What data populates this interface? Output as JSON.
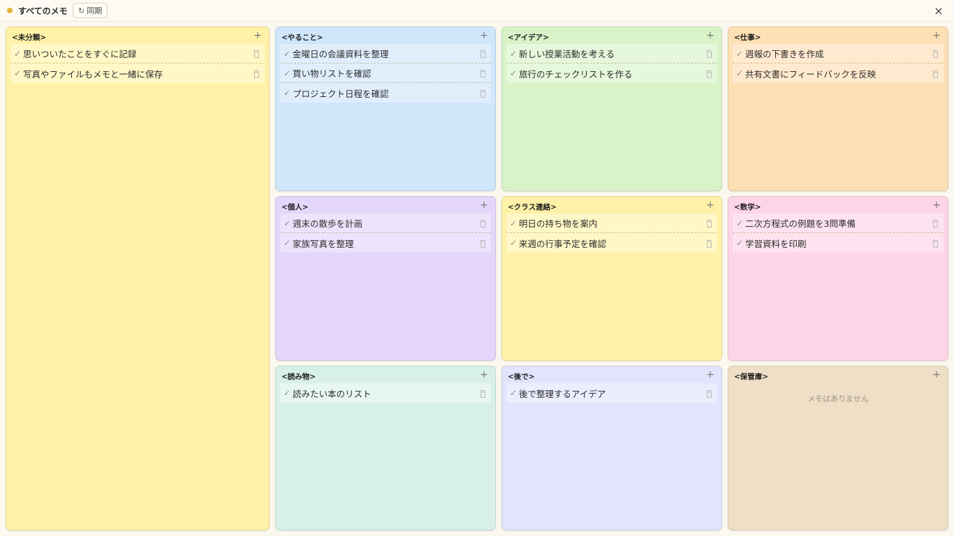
{
  "header": {
    "title": "すべてのメモ",
    "sync_icon": "↻",
    "sync_label": "同期",
    "close_icon": "×"
  },
  "icons": {
    "add": "+",
    "check": "✓"
  },
  "colors": {
    "status_dot": "#e3b63a"
  },
  "panels": [
    {
      "id": "uncategorized",
      "title": "<未分類>",
      "bg": "#fff2a8",
      "note_bg": "#fff7c6",
      "notes": [
        "思いついたことをすぐに記録",
        "写真やファイルもメモと一緒に保存"
      ],
      "empty_text": ""
    },
    {
      "id": "todo",
      "title": "<やること>",
      "bg": "#cfe6fb",
      "note_bg": "#e0eefc",
      "notes": [
        "金曜日の会議資料を整理",
        "買い物リストを確認",
        "プロジェクト日程を確認"
      ],
      "empty_text": ""
    },
    {
      "id": "ideas",
      "title": "<アイデア>",
      "bg": "#d8f3c8",
      "note_bg": "#e6f8dc",
      "notes": [
        "新しい授業活動を考える",
        "旅行のチェックリストを作る"
      ],
      "empty_text": ""
    },
    {
      "id": "work",
      "title": "<仕事>",
      "bg": "#fde0b4",
      "note_bg": "#ffeacf",
      "notes": [
        "週報の下書きを作成",
        "共有文書にフィードバックを反映"
      ],
      "empty_text": ""
    },
    {
      "id": "personal",
      "title": "<個人>",
      "bg": "#e5d6fb",
      "note_bg": "#eee3fc",
      "notes": [
        "週末の散歩を計画",
        "家族写真を整理"
      ],
      "empty_text": ""
    },
    {
      "id": "class",
      "title": "<クラス連絡>",
      "bg": "#fff2a8",
      "note_bg": "#fff7c6",
      "notes": [
        "明日の持ち物を案内",
        "来週の行事予定を確認"
      ],
      "empty_text": ""
    },
    {
      "id": "math",
      "title": "<数学>",
      "bg": "#fdd5e7",
      "note_bg": "#fde3ef",
      "notes": [
        "二次方程式の例題を3問準備",
        "学習資料を印刷"
      ],
      "empty_text": ""
    },
    {
      "id": "reading",
      "title": "<読み物>",
      "bg": "#d7f0ea",
      "note_bg": "#e7f6f2",
      "notes": [
        "読みたい本のリスト"
      ],
      "empty_text": ""
    },
    {
      "id": "later",
      "title": "<後で>",
      "bg": "#e2e3fc",
      "note_bg": "#ecedfd",
      "notes": [
        "後で整理するアイデア"
      ],
      "empty_text": ""
    },
    {
      "id": "archive",
      "title": "<保管庫>",
      "bg": "#efdfc7",
      "note_bg": "#f5e9d7",
      "notes": [],
      "empty_text": "メモはありません"
    }
  ]
}
